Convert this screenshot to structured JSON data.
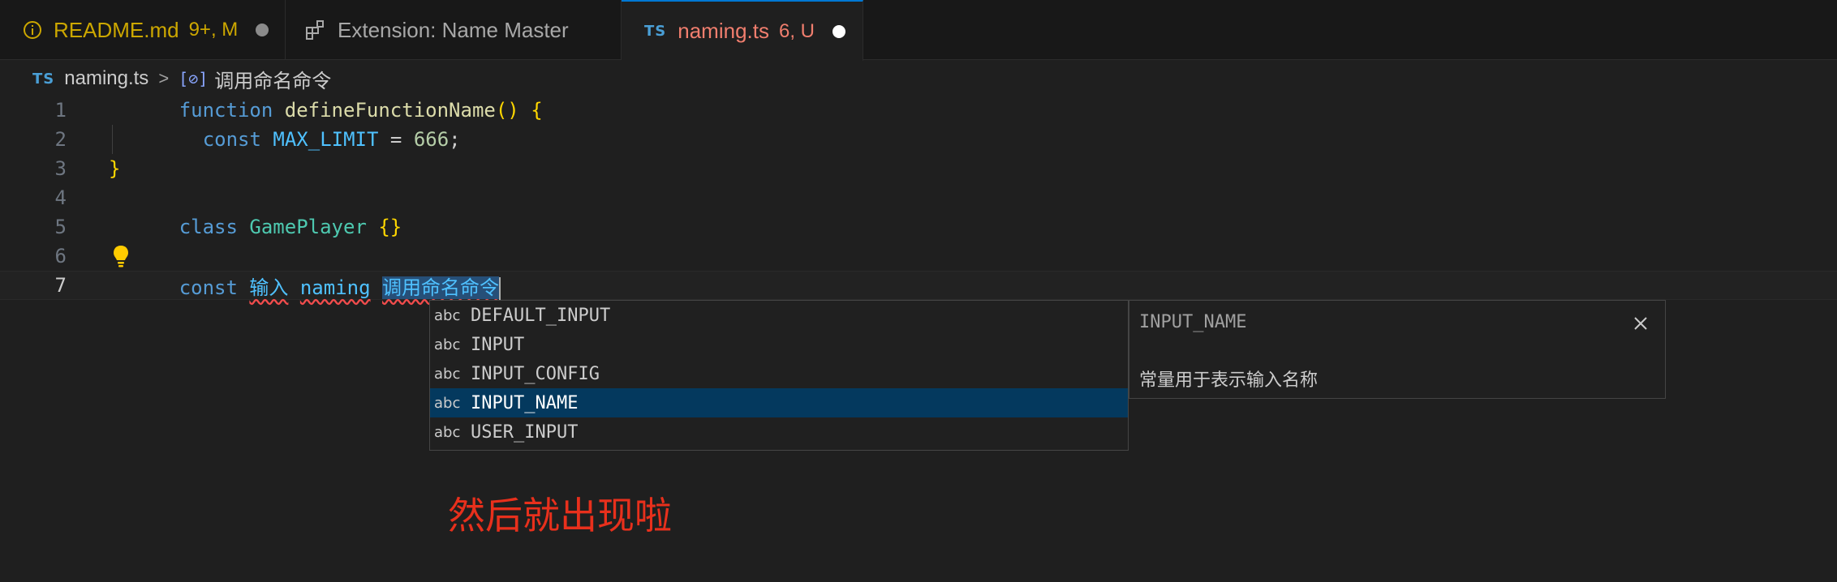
{
  "tabs": [
    {
      "icon": "info-icon",
      "name": "README.md",
      "status": "9+, M"
    },
    {
      "icon": "extensions-icon",
      "name": "Extension: Name Master",
      "status": ""
    },
    {
      "icon": "typescript-icon",
      "badge": "TS",
      "name": "naming.ts",
      "status": "6, U"
    }
  ],
  "breadcrumb": {
    "badge": "TS",
    "file": "naming.ts",
    "separator": ">",
    "symbol_icon": "[⊘]",
    "symbol": "调用命名命令"
  },
  "editor": {
    "line_numbers": [
      "1",
      "2",
      "3",
      "4",
      "5",
      "6",
      "7"
    ],
    "tokens": {
      "l1_kw": "function",
      "l1_fn": "defineFunctionName",
      "l1_br": "() {",
      "l2_kw": "const",
      "l2_var": "MAX_LIMIT",
      "l2_eq": " = ",
      "l2_num": "666",
      "l2_semi": ";",
      "l3_br": "}",
      "l5_kw": "class",
      "l5_cls": "GamePlayer",
      "l5_br": "{}",
      "l7_kw": "const",
      "l7_w1": "输入",
      "l7_w2": "naming",
      "l7_w3": "调用命名命令"
    }
  },
  "suggest": {
    "kind_label": "abc",
    "items": [
      "DEFAULT_INPUT",
      "INPUT",
      "INPUT_CONFIG",
      "INPUT_NAME",
      "USER_INPUT"
    ],
    "selected_index": 3,
    "details": {
      "title": "INPUT_NAME",
      "doc": "常量用于表示输入名称"
    }
  },
  "annotation": "然后就出现啦",
  "colors": {
    "accent": "#0078d4",
    "selection": "#04395e",
    "annotation": "#e8301c"
  }
}
